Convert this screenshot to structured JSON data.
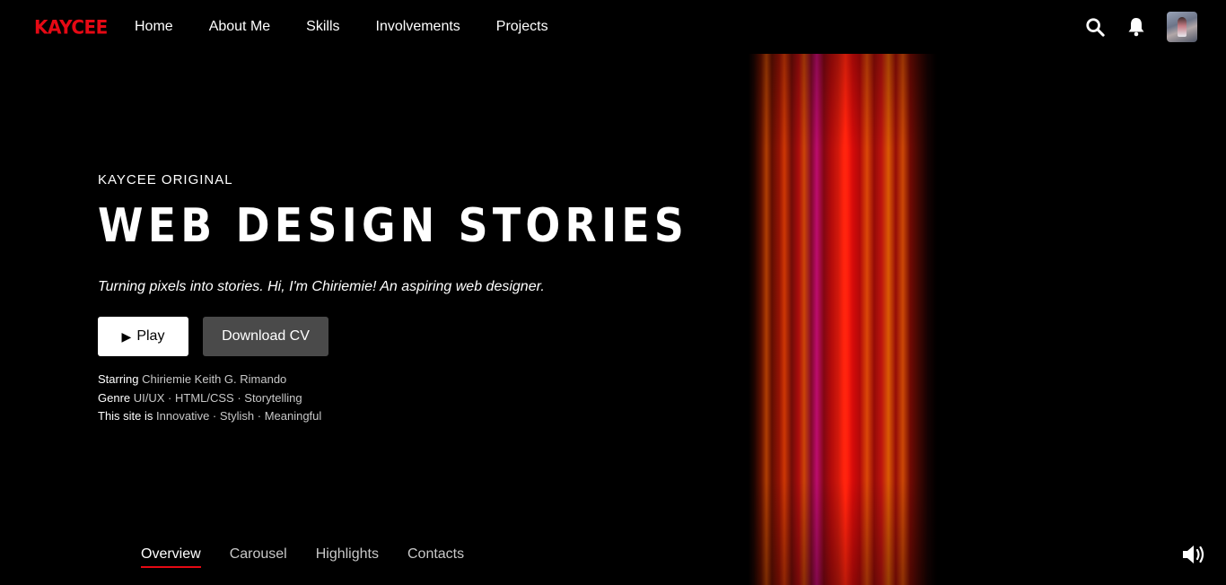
{
  "nav": {
    "logo": "KAYCEE",
    "links": [
      "Home",
      "About Me",
      "Skills",
      "Involvements",
      "Projects"
    ],
    "icons": [
      "search-icon",
      "bell-icon"
    ]
  },
  "hero": {
    "eyebrow": "KAYCEE ORIGINAL",
    "title": "WEB DESIGN STORIES",
    "tagline": "Turning pixels into stories. Hi, I'm Chiriemie! An aspiring web designer.",
    "play_label": "Play",
    "cv_label": "Download CV",
    "meta": [
      {
        "key": "Starring",
        "value": "Chiriemie Keith G. Rimando"
      },
      {
        "key": "Genre",
        "value": "UI/UX · HTML/CSS · Storytelling"
      },
      {
        "key": "This site is",
        "value": "Innovative · Stylish · Meaningful"
      }
    ]
  },
  "tabs": [
    {
      "label": "Overview",
      "active": true
    },
    {
      "label": "Carousel",
      "active": false
    },
    {
      "label": "Highlights",
      "active": false
    },
    {
      "label": "Contacts",
      "active": false
    }
  ],
  "colors": {
    "accent": "#e50914",
    "background": "#000000",
    "secondary_button": "#4a4a4a"
  }
}
